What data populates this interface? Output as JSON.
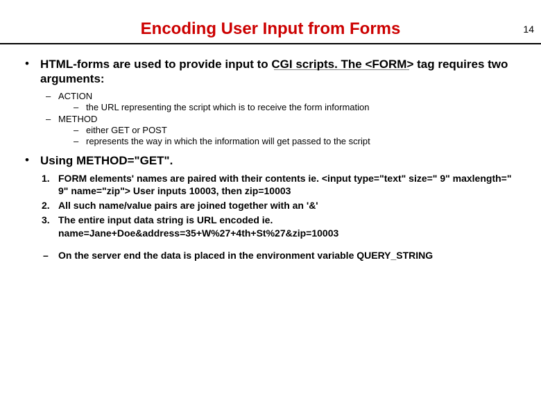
{
  "page_number": "14",
  "title": "Encoding User Input from Forms",
  "bullet1": {
    "text": "HTML-forms are used to provide input to CGI scripts. The <FORM> tag requires two arguments:",
    "sub": [
      {
        "label": "ACTION",
        "items": [
          "the URL representing the script which is to receive the form information"
        ]
      },
      {
        "label": "METHOD",
        "items": [
          "either GET or POST",
          "represents the way in which the information will get passed to the script"
        ]
      }
    ]
  },
  "bullet2": {
    "text": "Using METHOD=\"GET\".",
    "numbered": [
      "FORM elements' names are paired with their contents  ie. <input type=\"text\" size=\" 9\" maxlength=\" 9\" name=\"zip\"> User inputs 10003, then zip=10003",
      "All such name/value pairs are joined together with an '&'",
      "The entire input data  string is URL encoded ie. name=Jane+Doe&address=35+W%27+4th+St%27&zip=10003"
    ],
    "server_note": "On the server end the data is placed in the environment variable QUERY_STRING"
  }
}
